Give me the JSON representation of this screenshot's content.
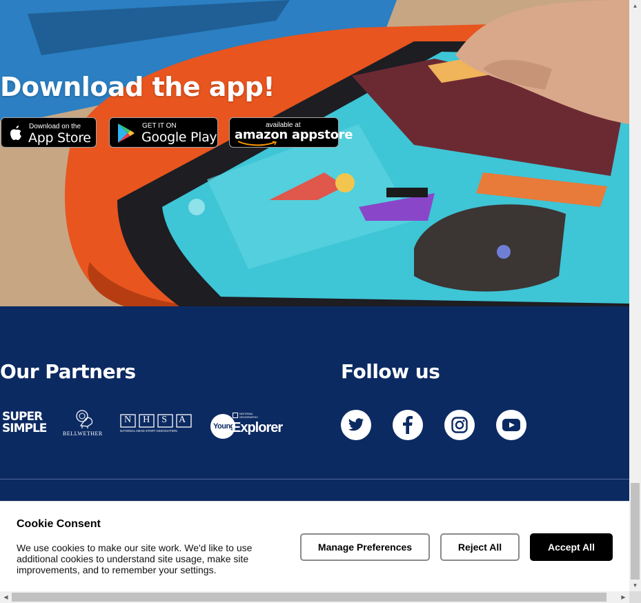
{
  "hero": {
    "title": "Download the app!",
    "stores": [
      {
        "small": "Download on the",
        "big": "App Store"
      },
      {
        "small": "GET IT ON",
        "big": "Google Play"
      },
      {
        "small": "available at",
        "big": "amazon appstore"
      }
    ]
  },
  "partners": {
    "heading": "Our Partners",
    "logos": [
      {
        "line1": "SUPER",
        "line2": "SIMPLE"
      },
      {
        "name": "BELLWETHER"
      },
      {
        "letters": "NHSA",
        "sub": "NATIONAL HEAD START ASSOCIATION"
      },
      {
        "left": "Young",
        "right": "Explorer",
        "tiny": "NATIONAL GEOGRAPHIC"
      }
    ]
  },
  "follow": {
    "heading": "Follow us",
    "icons": [
      "twitter-icon",
      "facebook-icon",
      "instagram-icon",
      "youtube-icon"
    ]
  },
  "cookie": {
    "title": "Cookie Consent",
    "text": "We use cookies to make our site work. We'd like to use additional cookies to understand site usage, make site improvements, and to remember your settings.",
    "manage": "Manage Preferences",
    "reject": "Reject All",
    "accept": "Accept All"
  },
  "colors": {
    "band": "#0c2a62",
    "tablet_frame": "#e8551f",
    "screen": "#3ec5d6"
  }
}
